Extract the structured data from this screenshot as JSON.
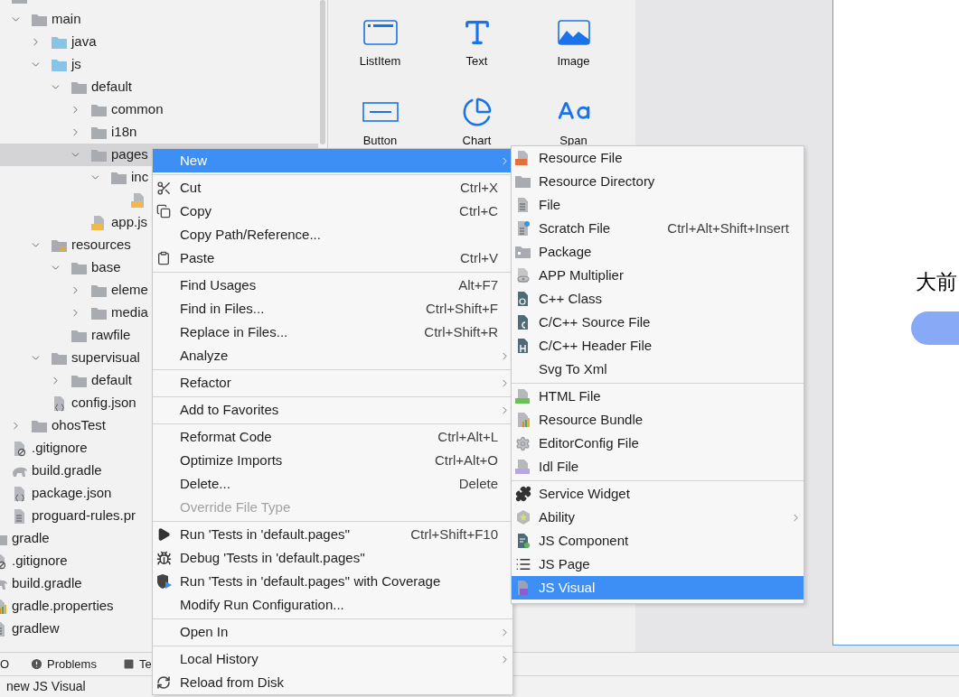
{
  "project_tree": {
    "items": [
      {
        "children": [
          {
            "kind": "folder",
            "selected": false,
            "children": [
              {
                "label": "main",
                "kind": "folder",
                "expanded": true,
                "selected": false,
                "children": [
                  {
                    "label": "java",
                    "kind": "source-folder",
                    "expanded": false,
                    "selected": false
                  },
                  {
                    "label": "js",
                    "kind": "source-folder",
                    "expanded": true,
                    "selected": false,
                    "children": [
                      {
                        "label": "default",
                        "kind": "folder",
                        "expanded": true,
                        "selected": false,
                        "children": [
                          {
                            "label": "common",
                            "kind": "folder",
                            "expanded": false,
                            "selected": false
                          },
                          {
                            "label": "i18n",
                            "kind": "folder",
                            "expanded": false,
                            "selected": false
                          },
                          {
                            "label": "pages",
                            "kind": "folder",
                            "expanded": true,
                            "selected": true,
                            "children": [
                              {
                                "label": "inc",
                                "kind": "folder",
                                "expanded": true,
                                "selected": false,
                                "children": [
                                  {
                                    "kind": "js",
                                    "selected": false
                                  }
                                ]
                              }
                            ]
                          },
                          {
                            "label": "app.js",
                            "kind": "js",
                            "selected": false
                          }
                        ]
                      }
                    ]
                  },
                  {
                    "label": "resources",
                    "kind": "resource-folder",
                    "expanded": true,
                    "selected": false,
                    "children": [
                      {
                        "label": "base",
                        "kind": "folder",
                        "expanded": true,
                        "selected": false,
                        "children": [
                          {
                            "label": "eleme",
                            "kind": "folder",
                            "expanded": false,
                            "selected": false
                          },
                          {
                            "label": "media",
                            "kind": "folder",
                            "expanded": false,
                            "selected": false
                          }
                        ]
                      },
                      {
                        "label": "rawfile",
                        "kind": "folder",
                        "selected": false
                      }
                    ]
                  },
                  {
                    "label": "supervisual",
                    "kind": "folder",
                    "expanded": true,
                    "selected": false,
                    "children": [
                      {
                        "label": "default",
                        "kind": "folder",
                        "expanded": false,
                        "selected": false
                      }
                    ]
                  },
                  {
                    "label": "config.json",
                    "kind": "json",
                    "selected": false
                  }
                ]
              },
              {
                "label": "ohosTest",
                "kind": "folder",
                "expanded": false,
                "selected": false
              }
            ]
          },
          {
            "label": ".gitignore",
            "kind": "ignore",
            "selected": false
          },
          {
            "label": "build.gradle",
            "kind": "gradle",
            "selected": false
          },
          {
            "label": "package.json",
            "kind": "json",
            "selected": false
          },
          {
            "label": "proguard-rules.pr",
            "kind": "text",
            "selected": false
          }
        ]
      },
      {
        "label": "gradle",
        "kind": "folder",
        "selected": false
      },
      {
        "label": ".gitignore",
        "kind": "ignore",
        "selected": false
      },
      {
        "label": "build.gradle",
        "kind": "gradle",
        "selected": false
      },
      {
        "label": "gradle.properties",
        "kind": "properties",
        "selected": false
      },
      {
        "label": "gradlew",
        "kind": "text",
        "selected": false
      }
    ]
  },
  "palette": {
    "components": [
      {
        "label": "ListItem",
        "kind": "list-item"
      },
      {
        "label": "Text",
        "kind": "text"
      },
      {
        "label": "Image",
        "kind": "image"
      },
      {
        "label": "Button",
        "kind": "button"
      },
      {
        "label": "Chart",
        "kind": "chart"
      },
      {
        "label": "Span",
        "kind": "span"
      }
    ]
  },
  "preview": {
    "text": "大前"
  },
  "context_menu": {
    "groups": [
      [
        {
          "label": "New",
          "submenu": true,
          "selected": true,
          "disabled": false
        }
      ],
      [
        {
          "label": "Cut",
          "kind": "cut",
          "shortcut": "Ctrl+X",
          "submenu": false,
          "selected": false,
          "disabled": false
        },
        {
          "label": "Copy",
          "kind": "copy",
          "shortcut": "Ctrl+C",
          "submenu": false,
          "selected": false,
          "disabled": false
        },
        {
          "label": "Copy Path/Reference...",
          "submenu": false,
          "selected": false,
          "disabled": false
        },
        {
          "label": "Paste",
          "kind": "paste",
          "shortcut": "Ctrl+V",
          "submenu": false,
          "selected": false,
          "disabled": false
        }
      ],
      [
        {
          "label": "Find Usages",
          "shortcut": "Alt+F7",
          "submenu": false,
          "selected": false,
          "disabled": false
        },
        {
          "label": "Find in Files...",
          "shortcut": "Ctrl+Shift+F",
          "submenu": false,
          "selected": false,
          "disabled": false
        },
        {
          "label": "Replace in Files...",
          "shortcut": "Ctrl+Shift+R",
          "submenu": false,
          "selected": false,
          "disabled": false
        },
        {
          "label": "Analyze",
          "submenu": true,
          "selected": false,
          "disabled": false
        }
      ],
      [
        {
          "label": "Refactor",
          "submenu": true,
          "selected": false,
          "disabled": false
        }
      ],
      [
        {
          "label": "Add to Favorites",
          "submenu": true,
          "selected": false,
          "disabled": false
        }
      ],
      [
        {
          "label": "Reformat Code",
          "shortcut": "Ctrl+Alt+L",
          "submenu": false,
          "selected": false,
          "disabled": false
        },
        {
          "label": "Optimize Imports",
          "shortcut": "Ctrl+Alt+O",
          "submenu": false,
          "selected": false,
          "disabled": false
        },
        {
          "label": "Delete...",
          "shortcut": "Delete",
          "submenu": false,
          "selected": false,
          "disabled": false
        },
        {
          "label": "Override File Type",
          "submenu": false,
          "selected": false,
          "disabled": true
        }
      ],
      [
        {
          "label": "Run 'Tests in 'default.pages''",
          "kind": "run",
          "shortcut": "Ctrl+Shift+F10",
          "submenu": false,
          "selected": false,
          "disabled": false
        },
        {
          "label": "Debug 'Tests in 'default.pages''",
          "kind": "debug",
          "submenu": false,
          "selected": false,
          "disabled": false
        },
        {
          "label": "Run 'Tests in 'default.pages'' with Coverage",
          "kind": "coverage",
          "submenu": false,
          "selected": false,
          "disabled": false
        },
        {
          "label": "Modify Run Configuration...",
          "submenu": false,
          "selected": false,
          "disabled": false
        }
      ],
      [
        {
          "label": "Open In",
          "submenu": true,
          "selected": false,
          "disabled": false
        }
      ],
      [
        {
          "label": "Local History",
          "submenu": true,
          "selected": false,
          "disabled": false
        },
        {
          "label": "Reload from Disk",
          "kind": "reload",
          "submenu": false,
          "selected": false,
          "disabled": false
        }
      ]
    ]
  },
  "new_submenu": {
    "groups": [
      [
        {
          "label": "Resource File",
          "kind": "resource-file",
          "submenu": false,
          "selected": false
        },
        {
          "label": "Resource Directory",
          "kind": "folder",
          "submenu": false,
          "selected": false
        },
        {
          "label": "File",
          "kind": "file",
          "submenu": false,
          "selected": false
        },
        {
          "label": "Scratch File",
          "kind": "scratch",
          "shortcut": "Ctrl+Alt+Shift+Insert",
          "submenu": false,
          "selected": false
        },
        {
          "label": "Package",
          "kind": "package",
          "submenu": false,
          "selected": false
        },
        {
          "label": "APP Multiplier",
          "kind": "multiplier",
          "submenu": false,
          "selected": false
        },
        {
          "label": "C++ Class",
          "kind": "cpp-class",
          "submenu": false,
          "selected": false
        },
        {
          "label": "C/C++ Source File",
          "kind": "c-source",
          "submenu": false,
          "selected": false
        },
        {
          "label": "C/C++ Header File",
          "kind": "c-header",
          "submenu": false,
          "selected": false
        },
        {
          "label": "Svg To Xml",
          "submenu": false,
          "selected": false
        }
      ],
      [
        {
          "label": "HTML File",
          "kind": "html",
          "submenu": false,
          "selected": false
        },
        {
          "label": "Resource Bundle",
          "kind": "bundle",
          "submenu": false,
          "selected": false
        },
        {
          "label": "EditorConfig File",
          "kind": "gear",
          "submenu": false,
          "selected": false
        },
        {
          "label": "Idl File",
          "kind": "idl",
          "submenu": false,
          "selected": false
        }
      ],
      [
        {
          "label": "Service Widget",
          "kind": "widget",
          "submenu": false,
          "selected": false
        },
        {
          "label": "Ability",
          "kind": "ability",
          "submenu": true,
          "selected": false
        },
        {
          "label": "JS Component",
          "kind": "js-component",
          "submenu": false,
          "selected": false
        },
        {
          "label": "JS Page",
          "kind": "js-page",
          "submenu": false,
          "selected": false
        },
        {
          "label": "JS Visual",
          "kind": "js-visual",
          "submenu": false,
          "selected": true
        }
      ]
    ]
  },
  "tool_window_bar": {
    "tabs": [
      {
        "label": "O"
      },
      {
        "label": "Problems",
        "kind": "problems"
      },
      {
        "label": "Te",
        "kind": "terminal"
      }
    ]
  },
  "status_bar": {
    "message": "new JS Visual"
  }
}
